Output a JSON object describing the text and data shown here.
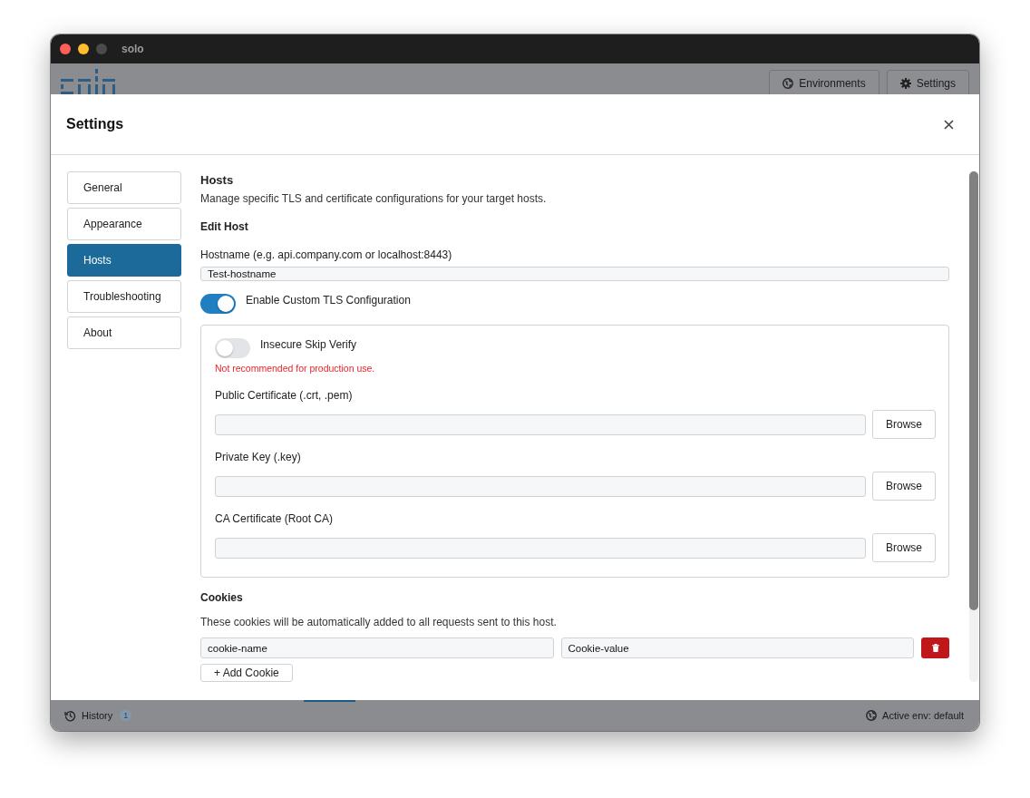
{
  "window": {
    "title": "solo"
  },
  "header": {
    "buttons": [
      {
        "label": "Environments"
      },
      {
        "label": "Settings"
      }
    ]
  },
  "modal": {
    "title": "Settings"
  },
  "nav": [
    {
      "label": "General",
      "selected": false
    },
    {
      "label": "Appearance",
      "selected": false
    },
    {
      "label": "Hosts",
      "selected": true
    },
    {
      "label": "Troubleshooting",
      "selected": false
    },
    {
      "label": "About",
      "selected": false
    }
  ],
  "section": {
    "title": "Hosts",
    "description": "Manage specific TLS and certificate configurations for your target hosts.",
    "subtitle": "Edit Host"
  },
  "hostname": {
    "label": "Hostname (e.g. api.company.com or localhost:8443)",
    "value": "Test-hostname"
  },
  "custom_tls": {
    "label": "Enable Custom TLS Configuration",
    "on": true
  },
  "insecure": {
    "label": "Insecure Skip Verify",
    "on": false,
    "warning": "Not recommended for production use."
  },
  "files": [
    {
      "label": "Public Certificate (.crt, .pem)",
      "button": "Browse"
    },
    {
      "label": "Private Key (.key)",
      "button": "Browse"
    },
    {
      "label": "CA Certificate (Root CA)",
      "button": "Browse"
    }
  ],
  "cookies": {
    "title": "Cookies",
    "description": "These cookies will be automatically added to all requests sent to this host.",
    "rows": [
      {
        "name": "cookie-name",
        "value": "Cookie-value"
      }
    ],
    "add_button": "+ Add Cookie"
  },
  "status_bar": {
    "history": "History",
    "history_count": "1",
    "active_env": "Active env: default"
  }
}
